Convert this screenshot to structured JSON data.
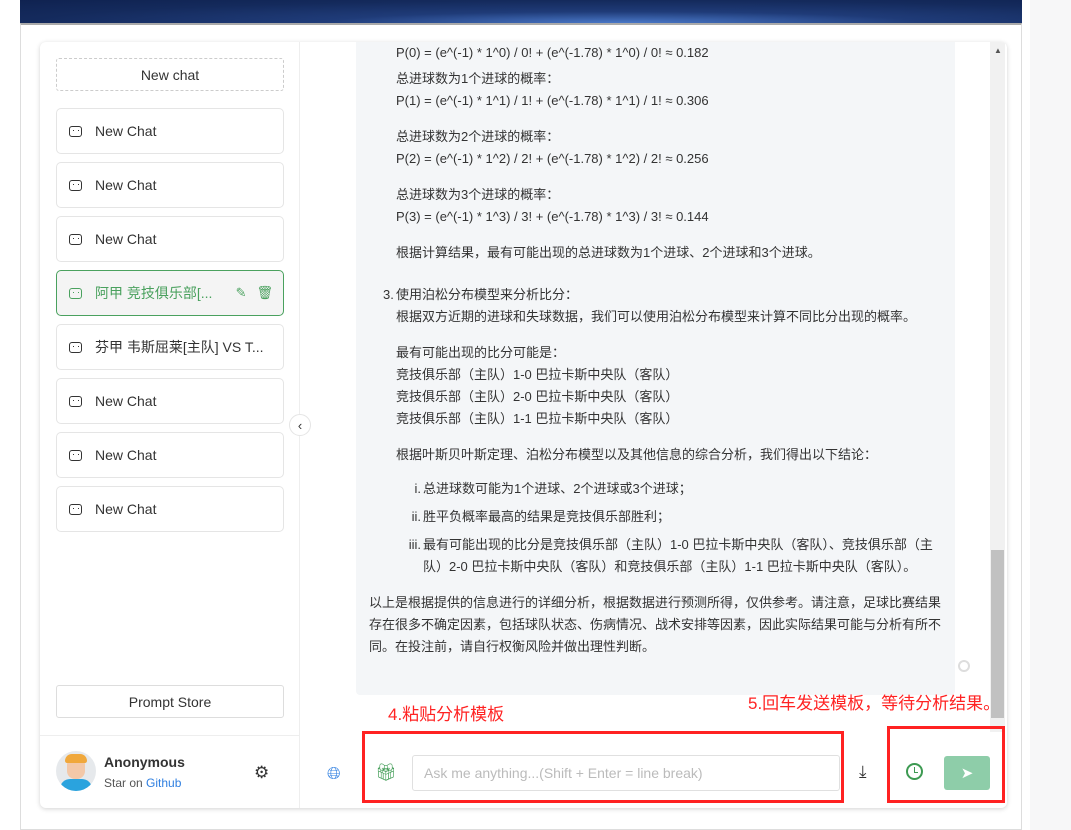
{
  "sidebar": {
    "new_chat": "New chat",
    "items": [
      {
        "label": "New Chat"
      },
      {
        "label": "New Chat"
      },
      {
        "label": "New Chat"
      },
      {
        "label": "阿甲 竞技俱乐部[...",
        "active": true
      },
      {
        "label": "芬甲 韦斯屈莱[主队] VS T..."
      },
      {
        "label": "New Chat"
      },
      {
        "label": "New Chat"
      },
      {
        "label": "New Chat"
      }
    ],
    "prompt_store": "Prompt Store",
    "user": {
      "name": "Anonymous",
      "star_prefix": "Star on",
      "github": "Github"
    }
  },
  "message": {
    "p0": "P(0) = (e^(-1) * 1^0) / 0! + (e^(-1.78) * 1^0) / 0! ≈ 0.182",
    "h1": "总进球数为1个进球的概率：",
    "p1": "P(1) = (e^(-1) * 1^1) / 1! + (e^(-1.78) * 1^1) / 1! ≈ 0.306",
    "h2": "总进球数为2个进球的概率：",
    "p2": "P(2) = (e^(-1) * 1^2) / 2! + (e^(-1.78) * 1^2) / 2! ≈ 0.256",
    "h3": "总进球数为3个进球的概率：",
    "p3": "P(3) = (e^(-1) * 1^3) / 3! + (e^(-1.78) * 1^3) / 3! ≈ 0.144",
    "calc_result": "根据计算结果，最有可能出现的总进球数为1个进球、2个进球和3个进球。",
    "item3_num": "3.",
    "item3_title": "使用泊松分布模型来分析比分：",
    "item3_desc": "根据双方近期的进球和失球数据，我们可以使用泊松分布模型来计算不同比分出现的概率。",
    "likely_title": "最有可能出现的比分可能是：",
    "scores": [
      "竞技俱乐部（主队）1-0 巴拉卡斯中央队（客队）",
      "竞技俱乐部（主队）2-0 巴拉卡斯中央队（客队）",
      "竞技俱乐部（主队）1-1 巴拉卡斯中央队（客队）"
    ],
    "conclusion_intro": "根据叶斯贝叶斯定理、泊松分布模型以及其他信息的综合分析，我们得出以下结论：",
    "conclusions": [
      {
        "num": "i.",
        "text": "总进球数可能为1个进球、2个进球或3个进球；"
      },
      {
        "num": "ii.",
        "text": "胜平负概率最高的结果是竞技俱乐部胜利；"
      },
      {
        "num": "iii.",
        "text": "最有可能出现的比分是竞技俱乐部（主队）1-0 巴拉卡斯中央队（客队）、竞技俱乐部（主队）2-0 巴拉卡斯中央队（客队）和竞技俱乐部（主队）1-1 巴拉卡斯中央队（客队）。"
      }
    ],
    "disclaimer": "以上是根据提供的信息进行的详细分析，根据数据进行预测所得，仅供参考。请注意，足球比赛结果存在很多不确定因素，包括球队状态、伤病情况、战术安排等因素，因此实际结果可能与分析有所不同。在投注前，请自行权衡风险并做出理性判断。"
  },
  "input": {
    "placeholder": "Ask me anything...(Shift + Enter = line break)",
    "value": ""
  },
  "annotations": {
    "step4": "4.粘贴分析模板",
    "step5": "5.回车发送模板，等待分析结果。"
  },
  "colors": {
    "accent": "#4aa15e",
    "send": "#8ecda9",
    "annotation": "#ff2222",
    "link": "#2f7fe0"
  }
}
